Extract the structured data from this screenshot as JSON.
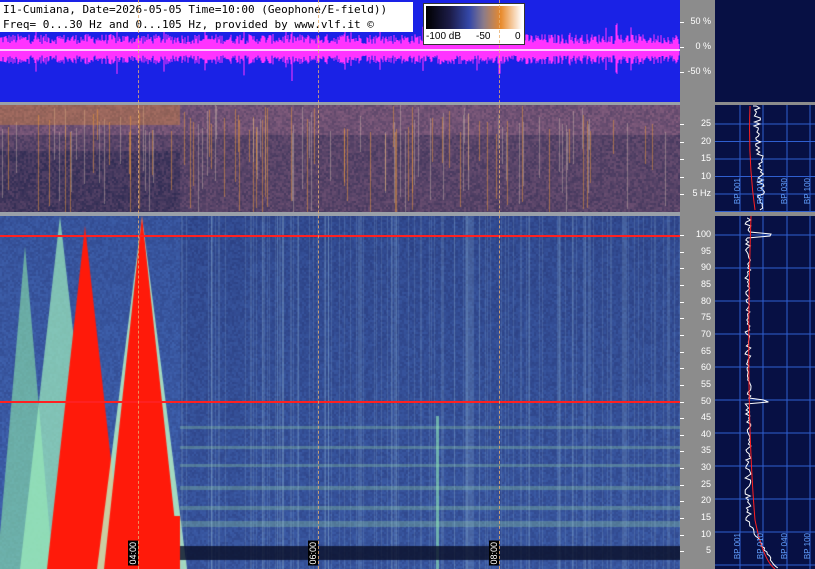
{
  "header": {
    "line1": "I1-Cumiana, Date=2026-05-05 Time=10:00 (Geophone/E-field))",
    "line2": "Freq= 0...30 Hz and 0...105 Hz, provided by www.vlf.it ©"
  },
  "colorbar": {
    "labels": [
      "-100 dB",
      "-50",
      "0"
    ]
  },
  "amplitude_axis": {
    "ticks": [
      "50 %",
      "0 %",
      "-50 %"
    ]
  },
  "low_freq_axis": {
    "ticks": [
      "25",
      "20",
      "15",
      "10",
      "5 Hz"
    ]
  },
  "main_freq_axis": {
    "ticks": [
      "100",
      "95",
      "90",
      "85",
      "80",
      "75",
      "70",
      "65",
      "60",
      "55",
      "50",
      "45",
      "40",
      "35",
      "30",
      "25",
      "20",
      "15",
      "10",
      "5"
    ]
  },
  "time_markers": [
    "04:00",
    "06:00",
    "08:00"
  ],
  "side_panel_top": {
    "labels": [
      "BP 001",
      "BP 010",
      "BP 030",
      "BP 100"
    ]
  },
  "side_panel_bottom": {
    "labels": [
      "BP 001",
      "BP 010",
      "BP 040",
      "BP 100"
    ]
  },
  "colors": {
    "waveform_bg": "#1a22e6",
    "waveform_trace": "#ff33ff",
    "hum_line": "#ff2020",
    "side_bg": "#071044",
    "grid": "#2f5fd0"
  }
}
